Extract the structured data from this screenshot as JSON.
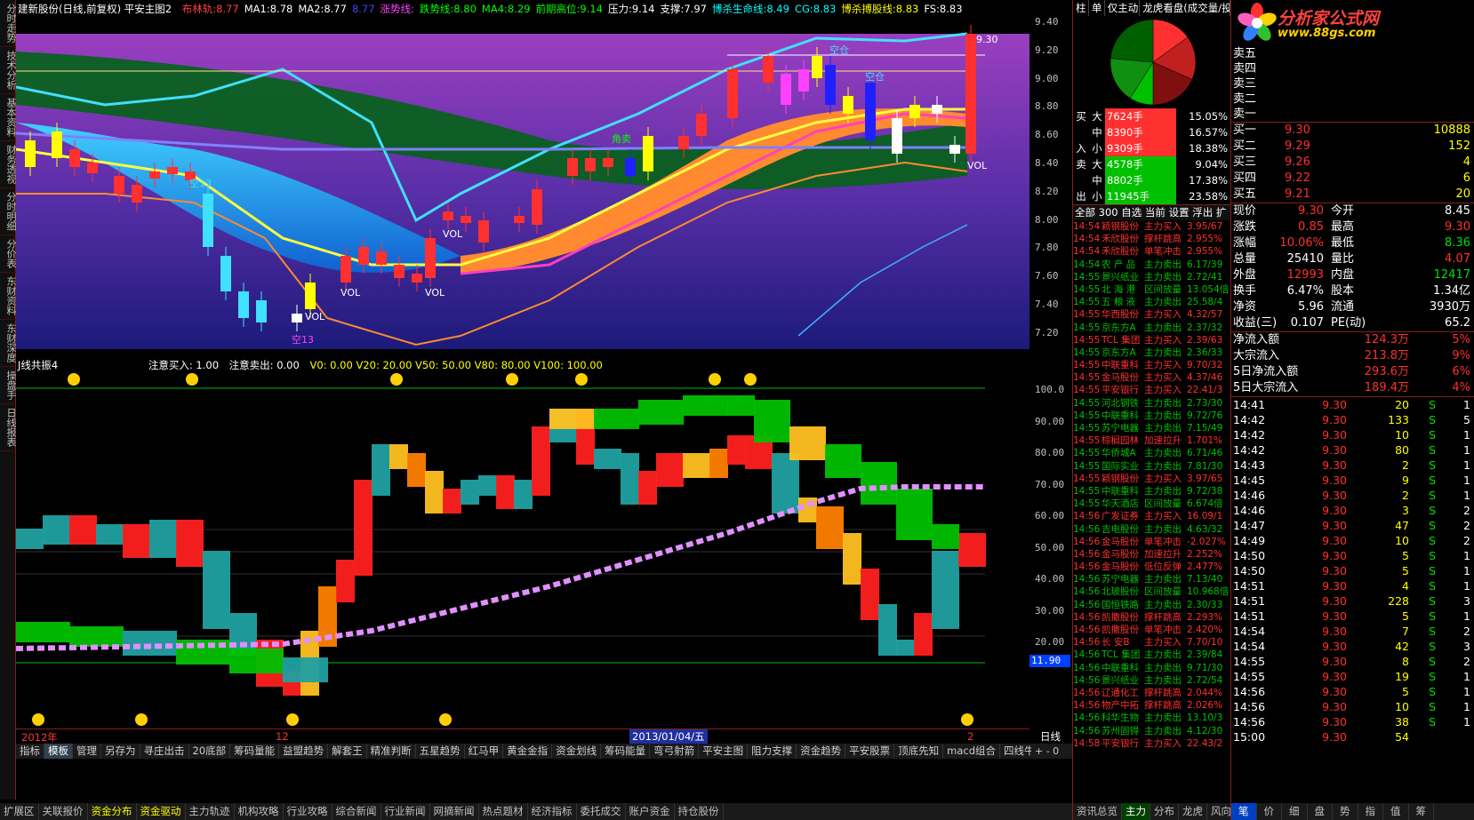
{
  "window": {
    "main_title": "建新股份(日线,前复权) 平安主图2",
    "indicators": [
      {
        "label": "布林轨:",
        "value": "8.77",
        "color": "#ff4040"
      },
      {
        "label": "MA1:",
        "value": "8.78",
        "color": "#ffffff"
      },
      {
        "label": "MA2:",
        "value": "8.77",
        "color": "#ffffff"
      },
      {
        "label": "",
        "value": "8.77",
        "color": "#4040ff"
      },
      {
        "label": "涨势线:",
        "value": "",
        "color": "#ff40ff"
      },
      {
        "label": "跌势线:",
        "value": "8.80",
        "color": "#00ff00"
      },
      {
        "label": "MA4:",
        "value": "8.29",
        "color": "#00ff00"
      },
      {
        "label": "前期高位:",
        "value": "9.14",
        "color": "#00ff00"
      },
      {
        "label": "压力:",
        "value": "9.14",
        "color": "#ffffff"
      },
      {
        "label": "支撑:",
        "value": "7.97",
        "color": "#ffffff"
      },
      {
        "label": "博杀生命线:",
        "value": "8.49",
        "color": "#00ffff"
      },
      {
        "label": "CG:",
        "value": "8.83",
        "color": "#00ffff"
      },
      {
        "label": "博杀搏股线:",
        "value": "8.83",
        "color": "#ffff00"
      },
      {
        "label": "FS:",
        "value": "8.83",
        "color": "#ffffff"
      }
    ]
  },
  "left_tabs": [
    "分时走势",
    "技术分析",
    "基本资料",
    "财务透视",
    "分时明细",
    "分价表",
    "东财资料",
    "东财深度",
    "操盘手",
    "日线报表"
  ],
  "price_axis": [
    "9.40",
    "9.20",
    "9.00",
    "8.80",
    "8.60",
    "8.40",
    "8.20",
    "8.00",
    "7.80",
    "7.60",
    "7.40",
    "7.20"
  ],
  "osc_axis": [
    "100.0",
    "90.00",
    "80.00",
    "70.00",
    "60.00",
    "50.00",
    "40.00",
    "30.00",
    "20.00"
  ],
  "osc_current": "11.90",
  "main_labels": [
    "空仓",
    "空仓",
    "角卖",
    "VOL",
    "VOL",
    "VOL",
    "VOL",
    "VOL",
    "空13",
    "空13",
    "9.30"
  ],
  "osc_title": {
    "name": "J线共振4",
    "buy_note": "注意买入: 1.00",
    "sell_note": "注意卖出: 0.00",
    "levels": "V0: 0.00  V20: 20.00  V50: 50.00  V80: 80.00  V100: 100.00"
  },
  "date_axis": {
    "y2012": "2012年",
    "m12": "12",
    "center": "2013/01/04/五",
    "m2": "2",
    "period": "日线"
  },
  "bottom_tabs": [
    "指标",
    "模板",
    "管理",
    "另存为",
    "寻庄出击",
    "20底部",
    "筹码量能",
    "益盟趋势",
    "解套王",
    "精准判断",
    "五星趋势",
    "红马甲",
    "黄金金指",
    "资金划线",
    "筹码能量",
    "弯弓射箭",
    "平安主图",
    "阻力支撑",
    "资金趋势",
    "平安股票",
    "顶底先知",
    "macd组合",
    "四线牛股"
  ],
  "bottom_bar": [
    "扩展区",
    "关联报价",
    "资金分布",
    "资金驱动",
    "主力轨迹",
    "机构攻略",
    "行业攻略",
    "综合新闻",
    "行业新闻",
    "网摘新闻",
    "热点题材",
    "经济指标",
    "委托成交",
    "账户资金",
    "持仓股份"
  ],
  "middle_panel": {
    "tabs": [
      "柱",
      "单",
      "仅主动",
      "龙虎看盘(成交量/投"
    ],
    "flow": [
      {
        "side": "买",
        "size": "大",
        "vol": "7624手",
        "pct": "15.05%",
        "color": "#ff3030"
      },
      {
        "side": "",
        "size": "中",
        "vol": "8390手",
        "pct": "16.57%",
        "color": "#ff3030"
      },
      {
        "side": "入",
        "size": "小",
        "vol": "9309手",
        "pct": "18.38%",
        "color": "#ff3030"
      },
      {
        "side": "卖",
        "size": "大",
        "vol": "4578手",
        "pct": "9.04%",
        "color": "#00c000"
      },
      {
        "side": "",
        "size": "中",
        "vol": "8802手",
        "pct": "17.38%",
        "color": "#00c000"
      },
      {
        "side": "出",
        "size": "小",
        "vol": "11945手",
        "pct": "23.58%",
        "color": "#00c000"
      }
    ],
    "list_tabs": "全部 300 自选 当前 设置 浮出 扩",
    "radar": [
      [
        "14:54",
        "颖钢股份",
        "主力买入",
        "3.95/67"
      ],
      [
        "14:54",
        "禾欣股份",
        "撑杆跳高",
        "2.955%"
      ],
      [
        "14:54",
        "禾欣股份",
        "单笔冲击",
        "2.955%"
      ],
      [
        "14:54",
        "农 产 品",
        "主力卖出",
        "6.17/39"
      ],
      [
        "14:55",
        "景兴纸业",
        "主力卖出",
        "2.72/41"
      ],
      [
        "14:55",
        "北 海 港",
        "区间放量",
        "13.054倍"
      ],
      [
        "14:55",
        "五 粮 液",
        "主力卖出",
        "25.58/4"
      ],
      [
        "14:55",
        "华西股份",
        "主力买入",
        "4.32/57"
      ],
      [
        "14:55",
        "京东方A",
        "主力卖出",
        "2.37/32"
      ],
      [
        "14:55",
        "TCL 集团",
        "主力买入",
        "2.39/63"
      ],
      [
        "14:55",
        "京东方A",
        "主力卖出",
        "2.36/33"
      ],
      [
        "14:55",
        "中联重科",
        "主力买入",
        "9.70/32"
      ],
      [
        "14:55",
        "金马股份",
        "主力买入",
        "4.37/46"
      ],
      [
        "14:55",
        "平安银行",
        "主力买入",
        "22.41/3"
      ],
      [
        "14:55",
        "河北钢铁",
        "主力卖出",
        "2.73/30"
      ],
      [
        "14:55",
        "中联重科",
        "主力卖出",
        "9.72/76"
      ],
      [
        "14:55",
        "苏宁电器",
        "主力卖出",
        "7.15/49"
      ],
      [
        "14:55",
        "棕榈园林",
        "加速拉升",
        "1.701%"
      ],
      [
        "14:55",
        "华侨城A",
        "主力卖出",
        "6.71/46"
      ],
      [
        "14:55",
        "国际实业",
        "主力卖出",
        "7.81/30"
      ],
      [
        "14:55",
        "颖钢股份",
        "主力买入",
        "3.97/65"
      ],
      [
        "14:55",
        "中联重科",
        "主力卖出",
        "9.72/38"
      ],
      [
        "14:55",
        "华天酒店",
        "区间放量",
        "6.674倍"
      ],
      [
        "14:56",
        "广发证券",
        "主力买入",
        "16.09/1"
      ],
      [
        "14:56",
        "吉电股份",
        "主力卖出",
        "4.63/32"
      ],
      [
        "14:56",
        "金马股份",
        "单笔冲击",
        "-2.027%"
      ],
      [
        "14:56",
        "金马股份",
        "加速拉升",
        "2.252%"
      ],
      [
        "14:56",
        "金马股份",
        "低位反弹",
        "2.477%"
      ],
      [
        "14:56",
        "苏宁电器",
        "主力卖出",
        "7.13/40"
      ],
      [
        "14:56",
        "北玻股份",
        "区间放量",
        "10.968倍"
      ],
      [
        "14:56",
        "国恒铁路",
        "主力卖出",
        "2.30/33"
      ],
      [
        "14:56",
        "凯撒股份",
        "撑杆跳高",
        "2.293%"
      ],
      [
        "14:56",
        "凯撒股份",
        "单笔冲击",
        "2.420%"
      ],
      [
        "14:56",
        "长  安B",
        "主力买入",
        "7.70/10"
      ],
      [
        "14:56",
        "TCL 集团",
        "主力卖出",
        "2.39/84"
      ],
      [
        "14:56",
        "中联重科",
        "主力卖出",
        "9.71/30"
      ],
      [
        "14:56",
        "景兴纸业",
        "主力卖出",
        "2.72/54"
      ],
      [
        "14:56",
        "辽通化工",
        "撑杆跳高",
        "2.044%"
      ],
      [
        "14:56",
        "物产中拓",
        "撑杆跳高",
        "2.026%"
      ],
      [
        "14:56",
        "科华生物",
        "主力卖出",
        "13.10/3"
      ],
      [
        "14:56",
        "苏州固锝",
        "主力卖出",
        "4.12/30"
      ],
      [
        "14:58",
        "平安银行",
        "主力买入",
        "22.43/2"
      ]
    ]
  },
  "right_panel": {
    "logo_main": "分析家公式网",
    "logo_url": "www.88gs.com",
    "asks_top": [
      "卖五",
      "卖四",
      "卖三",
      "卖二",
      "卖一"
    ],
    "bids": [
      {
        "label": "买一",
        "price": "9.30",
        "vol": "10888"
      },
      {
        "label": "买二",
        "price": "9.29",
        "vol": "152"
      },
      {
        "label": "买三",
        "price": "9.26",
        "vol": "4"
      },
      {
        "label": "买四",
        "price": "9.22",
        "vol": "6"
      },
      {
        "label": "买五",
        "price": "9.21",
        "vol": "20"
      }
    ],
    "stats": [
      {
        "l1": "现价",
        "v1": "9.30",
        "c1": "#ff3030",
        "l2": "今开",
        "v2": "8.45",
        "c2": "#ffffff"
      },
      {
        "l1": "涨跌",
        "v1": "0.85",
        "c1": "#ff3030",
        "l2": "最高",
        "v2": "9.30",
        "c2": "#ff3030"
      },
      {
        "l1": "涨幅",
        "v1": "10.06%",
        "c1": "#ff3030",
        "l2": "最低",
        "v2": "8.36",
        "c2": "#00e000"
      },
      {
        "l1": "总量",
        "v1": "25410",
        "c1": "#ffffff",
        "l2": "量比",
        "v2": "4.07",
        "c2": "#ff3030"
      },
      {
        "l1": "外盘",
        "v1": "12993",
        "c1": "#ff3030",
        "l2": "内盘",
        "v2": "12417",
        "c2": "#00e000"
      },
      {
        "l1": "换手",
        "v1": "6.47%",
        "c1": "#ffffff",
        "l2": "股本",
        "v2": "1.34亿",
        "c2": "#ffffff"
      },
      {
        "l1": "净资",
        "v1": "5.96",
        "c1": "#ffffff",
        "l2": "流通",
        "v2": "3930万",
        "c2": "#ffffff"
      },
      {
        "l1": "收益(三)",
        "v1": "0.107",
        "c1": "#ffffff",
        "l2": "PE(动)",
        "v2": "65.2",
        "c2": "#ffffff"
      }
    ],
    "flows": [
      {
        "label": "净流入额",
        "value": "124.3万",
        "pct": "5%"
      },
      {
        "label": "大宗流入",
        "value": "213.8万",
        "pct": "9%"
      },
      {
        "label": "5日净流入额",
        "value": "293.6万",
        "pct": "6%"
      },
      {
        "label": "5日大宗流入",
        "value": "189.4万",
        "pct": "4%"
      }
    ],
    "ticks": [
      [
        "14:41",
        "9.30",
        "20",
        "S",
        "1"
      ],
      [
        "14:42",
        "9.30",
        "133",
        "S",
        "5"
      ],
      [
        "14:42",
        "9.30",
        "10",
        "S",
        "1"
      ],
      [
        "14:42",
        "9.30",
        "80",
        "S",
        "1"
      ],
      [
        "14:43",
        "9.30",
        "2",
        "S",
        "1"
      ],
      [
        "14:45",
        "9.30",
        "9",
        "S",
        "1"
      ],
      [
        "14:46",
        "9.30",
        "2",
        "S",
        "1"
      ],
      [
        "14:46",
        "9.30",
        "3",
        "S",
        "2"
      ],
      [
        "14:47",
        "9.30",
        "47",
        "S",
        "2"
      ],
      [
        "14:49",
        "9.30",
        "10",
        "S",
        "2"
      ],
      [
        "14:50",
        "9.30",
        "5",
        "S",
        "1"
      ],
      [
        "14:50",
        "9.30",
        "5",
        "S",
        "1"
      ],
      [
        "14:51",
        "9.30",
        "4",
        "S",
        "1"
      ],
      [
        "14:51",
        "9.30",
        "228",
        "S",
        "3"
      ],
      [
        "14:51",
        "9.30",
        "5",
        "S",
        "1"
      ],
      [
        "14:54",
        "9.30",
        "7",
        "S",
        "2"
      ],
      [
        "14:54",
        "9.30",
        "42",
        "S",
        "3"
      ],
      [
        "14:55",
        "9.30",
        "8",
        "S",
        "2"
      ],
      [
        "14:55",
        "9.30",
        "19",
        "S",
        "1"
      ],
      [
        "14:56",
        "9.30",
        "5",
        "S",
        "1"
      ],
      [
        "14:56",
        "9.30",
        "10",
        "S",
        "1"
      ],
      [
        "14:56",
        "9.30",
        "38",
        "S",
        "1"
      ],
      [
        "15:00",
        "9.30",
        "54",
        "",
        ""
      ]
    ],
    "mid_bottom_tabs": [
      "资讯总览",
      "主力",
      "分布",
      "龙虎",
      "风向"
    ],
    "right_bottom_tabs": [
      "笔",
      "价",
      "细",
      "盘",
      "势",
      "指",
      "值",
      "筹"
    ]
  }
}
